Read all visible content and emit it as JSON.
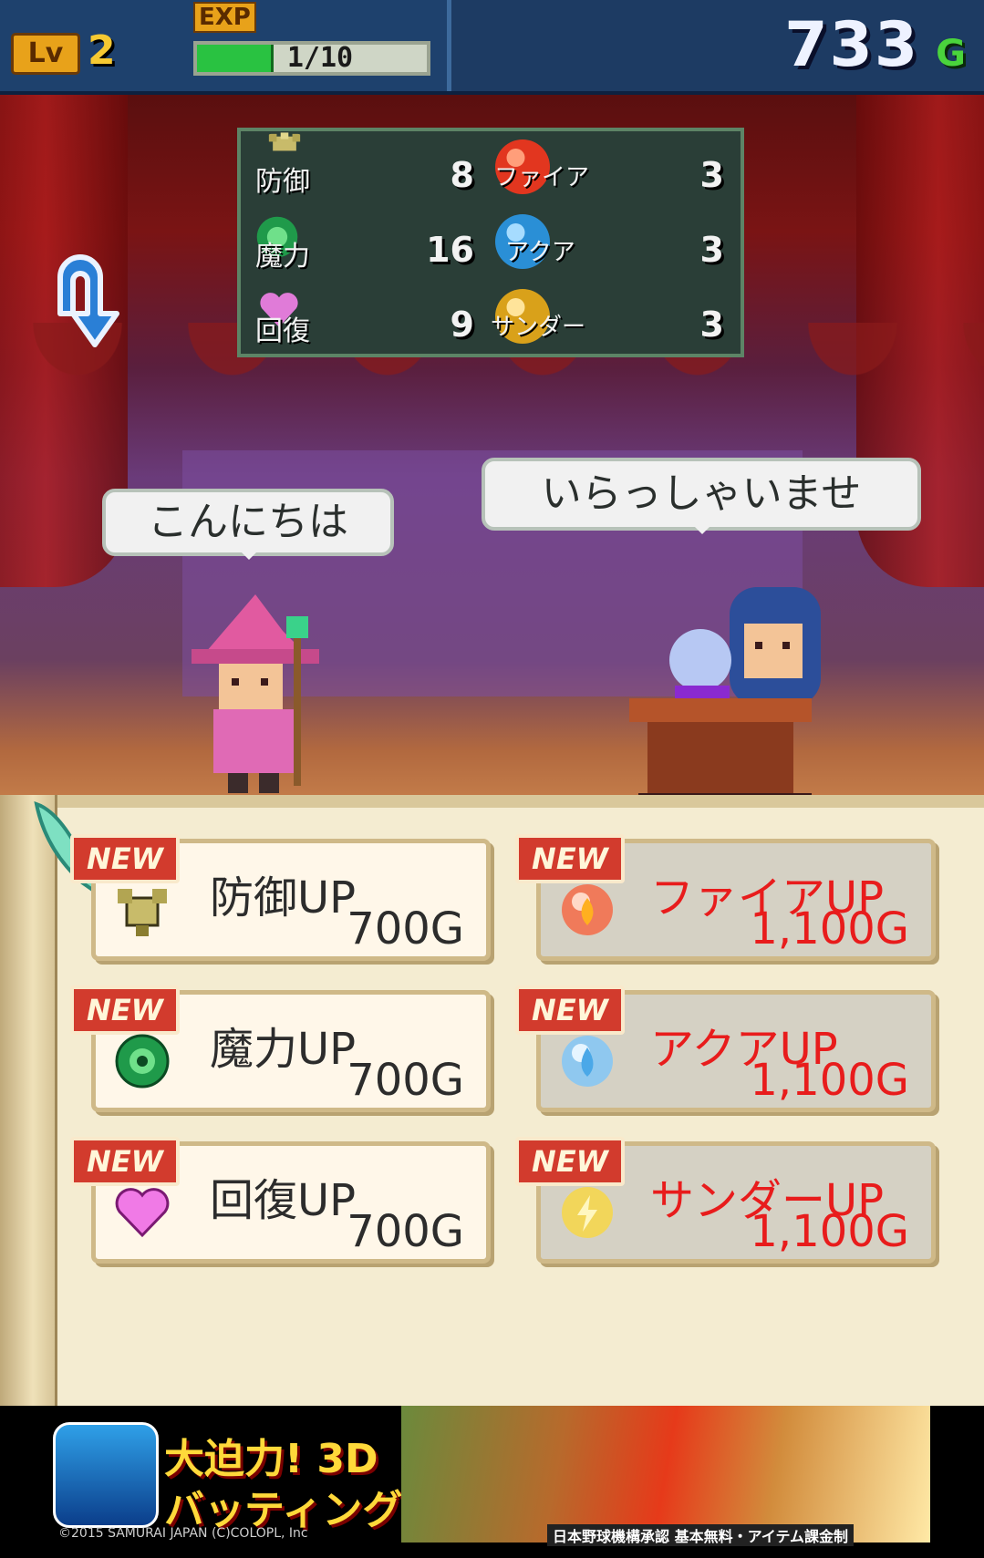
{
  "hud": {
    "lv_label": "Lv",
    "level": "2",
    "exp_label": "EXP",
    "exp_value": "1/10",
    "exp_progress": 0.32,
    "gold_amount": "733",
    "gold_unit": "G"
  },
  "stats": {
    "left": [
      {
        "label": "防御",
        "value": "8",
        "icon": "defense-emblem-icon"
      },
      {
        "label": "魔力",
        "value": "16",
        "icon": "magic-emblem-icon"
      },
      {
        "label": "回復",
        "value": "9",
        "icon": "heart-icon"
      }
    ],
    "right": [
      {
        "label": "ファイア",
        "value": "3",
        "icon": "fire-orb-icon"
      },
      {
        "label": "アクア",
        "value": "3",
        "icon": "aqua-orb-icon"
      },
      {
        "label": "サンダー",
        "value": "3",
        "icon": "thunder-orb-icon"
      }
    ]
  },
  "dialogue": {
    "customer": "こんにちは",
    "seller": "いらっしゃいませ"
  },
  "shop": {
    "badge": "NEW",
    "items": [
      {
        "name": "防御UP",
        "price": "700G",
        "icon": "defense-emblem-icon"
      },
      {
        "name": "ファイアUP",
        "price": "1,100G",
        "icon": "fire-orb-icon"
      },
      {
        "name": "魔力UP",
        "price": "700G",
        "icon": "magic-emblem-icon"
      },
      {
        "name": "アクアUP",
        "price": "1,100G",
        "icon": "aqua-orb-icon"
      },
      {
        "name": "回復UP",
        "price": "700G",
        "icon": "heart-icon"
      },
      {
        "name": "サンダーUP",
        "price": "1,100G",
        "icon": "thunder-orb-icon"
      }
    ]
  },
  "ad": {
    "line1": "大迫力! 3D",
    "line2": "バッティング!!",
    "copyright": "©2015 SAMURAI JAPAN (C)COLOPL, Inc",
    "tag": "日本野球機構承認  基本無料・アイテム課金制"
  },
  "colors": {
    "hud_bg": "#1e416d",
    "price_red": "#e81c1c",
    "scroll_bg": "#f4ecd1",
    "stats_bg": "#2a3e37"
  }
}
